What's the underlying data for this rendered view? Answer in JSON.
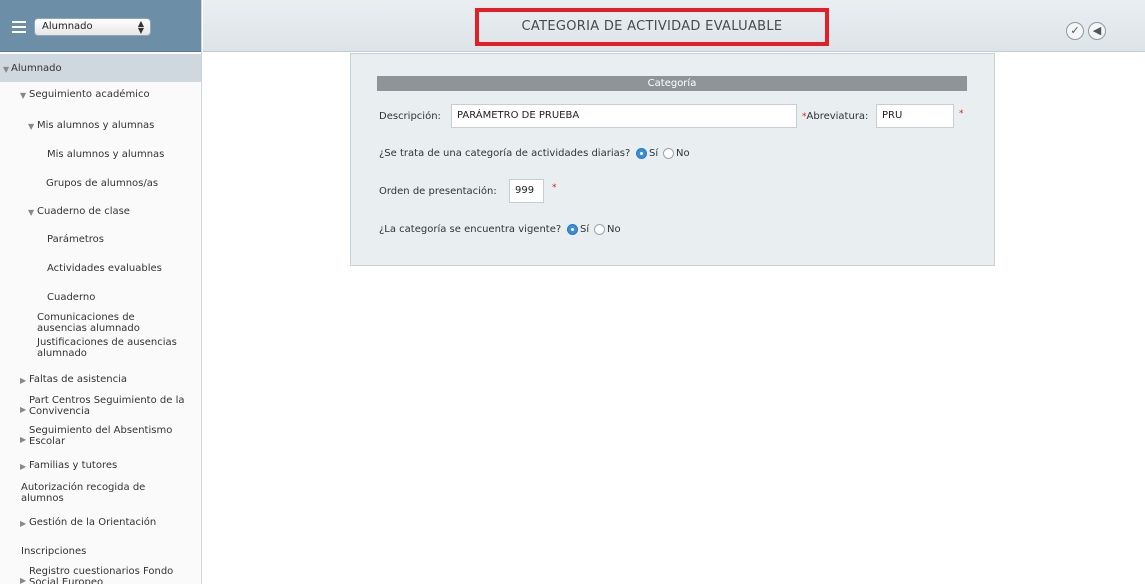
{
  "profile": {
    "selected": "Alumnado"
  },
  "menu": {
    "root": "Alumnado",
    "seguimiento": "Seguimiento académico",
    "mis_alumnos_group": "Mis alumnos y alumnas",
    "mis_alumnos": "Mis alumnos y alumnas",
    "grupos": "Grupos de alumnos/as",
    "cuaderno_group": "Cuaderno de clase",
    "parametros": "Parámetros",
    "actividades": "Actividades evaluables",
    "cuaderno": "Cuaderno",
    "comunicaciones": "Comunicaciones de ausencias alumnado",
    "justificaciones": "Justificaciones de ausencias alumnado",
    "faltas": "Faltas de asistencia",
    "part_centros": "Part Centros Seguimiento de la Convivencia",
    "absentismo": "Seguimiento del Absentismo Escolar",
    "familias": "Familias y tutores",
    "autorizacion": "Autorización recogida de alumnos",
    "orientacion": "Gestión de la Orientación",
    "inscripciones": "Inscripciones",
    "registro": "Registro cuestionarios Fondo Social Europeo"
  },
  "header": {
    "title": "CATEGORIA DE ACTIVIDAD EVALUABLE",
    "accept_icon": "✓",
    "back_icon": "◀"
  },
  "form": {
    "section_title": "Categoría",
    "descripcion_label": "Descripción:",
    "descripcion_value": "PARÁMETRO DE PRUEBA",
    "req_mark": "*",
    "abreviatura_label": "Abreviatura:",
    "abreviatura_value": "PRU",
    "diarias_question": "¿Se trata de una categoría de actividades diarias?",
    "si": "Sí",
    "no": "No",
    "orden_label": "Orden de presentación:",
    "orden_value": "999",
    "vigente_question": "¿La categoría se encuentra vigente?"
  },
  "colors": {
    "accent": "#3a8ed8",
    "highlight_border": "#e21f26"
  }
}
